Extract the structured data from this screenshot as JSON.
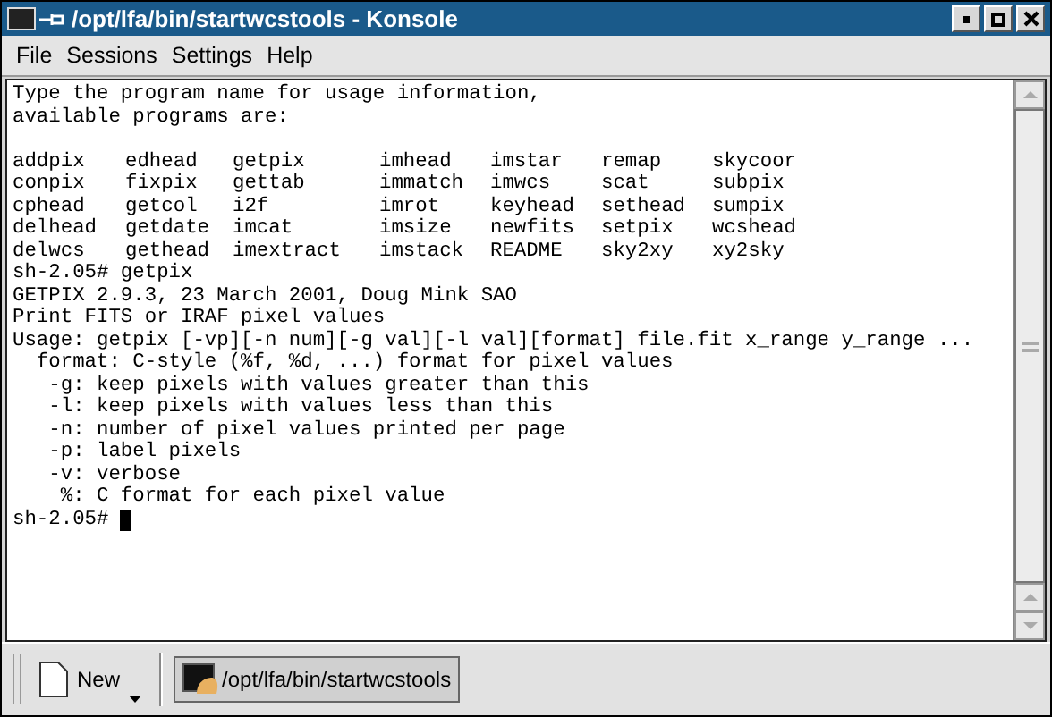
{
  "window": {
    "title": "/opt/lfa/bin/startwcstools - Konsole"
  },
  "menu": [
    "File",
    "Sessions",
    "Settings",
    "Help"
  ],
  "terminal": {
    "intro": [
      "Type the program name for usage information,",
      "available programs are:"
    ],
    "programs": [
      [
        "addpix",
        "edhead",
        "getpix",
        "imhead",
        "imstar",
        "remap",
        "skycoor"
      ],
      [
        "conpix",
        "fixpix",
        "gettab",
        "immatch",
        "imwcs",
        "scat",
        "subpix"
      ],
      [
        "cphead",
        "getcol",
        "i2f",
        "imrot",
        "keyhead",
        "sethead",
        "sumpix"
      ],
      [
        "delhead",
        "getdate",
        "imcat",
        "imsize",
        "newfits",
        "setpix",
        "wcshead"
      ],
      [
        "delwcs",
        "gethead",
        "imextract",
        "imstack",
        "README",
        "sky2xy",
        "xy2sky"
      ]
    ],
    "output": [
      "sh-2.05# getpix",
      "GETPIX 2.9.3, 23 March 2001, Doug Mink SAO",
      "Print FITS or IRAF pixel values",
      "Usage: getpix [-vp][-n num][-g val][-l val][format] file.fit x_range y_range ...",
      "  format: C-style (%f, %d, ...) format for pixel values",
      "   -g: keep pixels with values greater than this",
      "   -l: keep pixels with values less than this",
      "   -n: number of pixel values printed per page",
      "   -p: label pixels",
      "   -v: verbose",
      "    %: C format for each pixel value"
    ],
    "prompt": "sh-2.05# "
  },
  "taskbar": {
    "new_button": "New",
    "session_tab": "/opt/lfa/bin/startwcstools"
  }
}
